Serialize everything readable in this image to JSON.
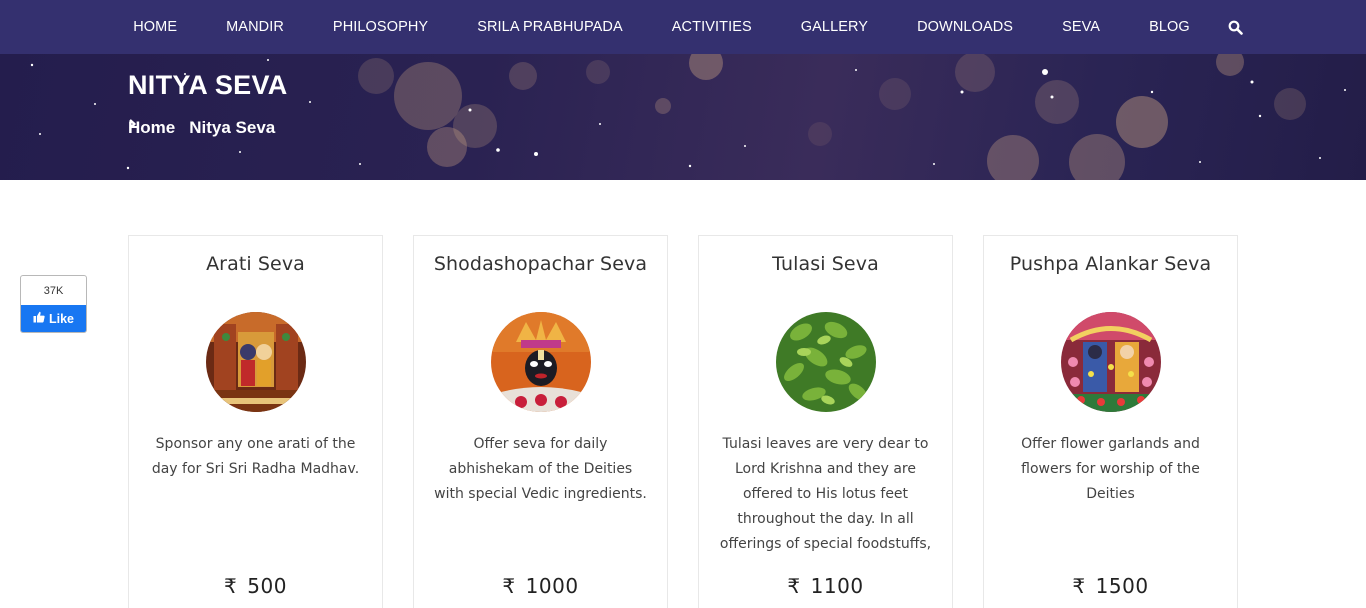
{
  "nav": {
    "items": [
      "HOME",
      "MANDIR",
      "PHILOSOPHY",
      "SRILA PRABHUPADA",
      "ACTIVITIES",
      "GALLERY",
      "DOWNLOADS",
      "SEVA",
      "BLOG"
    ],
    "search_icon": "search-icon"
  },
  "banner": {
    "title": "NITYA SEVA",
    "breadcrumb": {
      "home": "Home",
      "current": "Nitya Seva"
    }
  },
  "facebook": {
    "count": "37K",
    "like_label": "Like"
  },
  "currency_symbol": "₹",
  "cards": [
    {
      "title": "Arati Seva",
      "description": "Sponsor any one arati of the day for Sri Sri Radha Madhav.",
      "price": "500",
      "image": "deity-altar-image"
    },
    {
      "title": "Shodashopachar Seva",
      "description": "Offer seva for daily abhishekam of the Deities with special Vedic ingredients.",
      "price": "1000",
      "image": "deity-face-image"
    },
    {
      "title": "Tulasi Seva",
      "description": "Tulasi leaves are very dear to Lord Krishna and they are offered to His lotus feet throughout the day. In all offerings of special foodstuffs,",
      "price": "1100",
      "image": "tulasi-plant-image"
    },
    {
      "title": "Pushpa Alankar Seva",
      "description": "Offer flower garlands and flowers for worship of the Deities",
      "price": "1500",
      "image": "flower-decorated-deities-image"
    }
  ],
  "colors": {
    "nav_bg": "#34306f",
    "banner_bg": "#2a2252",
    "fb_blue": "#1877f2"
  }
}
